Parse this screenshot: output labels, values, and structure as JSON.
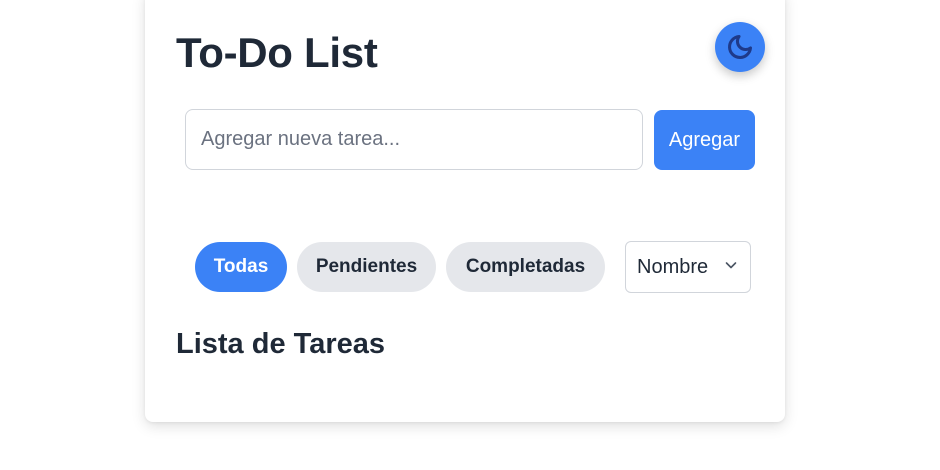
{
  "app": {
    "title": "To-Do List"
  },
  "theme_toggle": {
    "icon": "moon-icon",
    "accent": "#3b82f6",
    "icon_color": "#1e3a8a"
  },
  "new_task": {
    "value": "",
    "placeholder": "Agregar nueva tarea...",
    "add_label": "Agregar"
  },
  "filters": [
    {
      "label": "Todas",
      "active": true
    },
    {
      "label": "Pendientes",
      "active": false
    },
    {
      "label": "Completadas",
      "active": false
    }
  ],
  "sort": {
    "selected": "Nombre",
    "icon": "chevron-down-icon"
  },
  "list": {
    "heading": "Lista de Tareas",
    "items": []
  },
  "colors": {
    "primary": "#3b82f6",
    "text": "#1f2937",
    "chip_inactive": "#e5e7eb",
    "border": "#d1d5db"
  }
}
